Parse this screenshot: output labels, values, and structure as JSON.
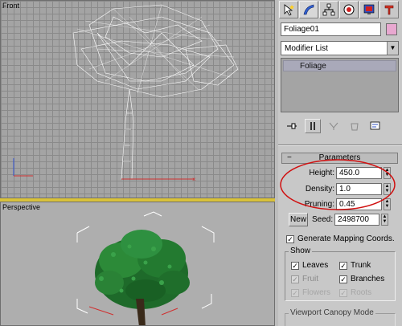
{
  "viewports": {
    "front": {
      "label": "Front"
    },
    "perspective": {
      "label": "Perspective"
    }
  },
  "panel": {
    "tabs": [
      {
        "name": "create-tab-icon"
      },
      {
        "name": "modify-tab-icon"
      },
      {
        "name": "hierarchy-tab-icon"
      },
      {
        "name": "motion-tab-icon"
      },
      {
        "name": "display-tab-icon"
      },
      {
        "name": "utilities-tab-icon"
      }
    ],
    "object_name": "Foliage01",
    "object_color": "#e8a8d0",
    "modifier_list": "Modifier List",
    "stack_item": "Foliage"
  },
  "parameters": {
    "title": "Parameters",
    "height_label": "Height:",
    "height_value": "450.0",
    "density_label": "Density:",
    "density_value": "1.0",
    "pruning_label": "Pruning:",
    "pruning_value": "0.45",
    "new_label": "New",
    "seed_label": "Seed:",
    "seed_value": "2498700",
    "gen_mapping_label": "Generate Mapping Coords.",
    "gen_mapping_checked": true
  },
  "show": {
    "title": "Show",
    "leaves": "Leaves",
    "trunk": "Trunk",
    "fruit": "Fruit",
    "branches": "Branches",
    "flowers": "Flowers",
    "roots": "Roots"
  },
  "canopy": {
    "title": "Viewport Canopy Mode"
  },
  "colors": {
    "annotation_ellipse": "#d01010",
    "stack_highlight": "#a9a9b9"
  }
}
